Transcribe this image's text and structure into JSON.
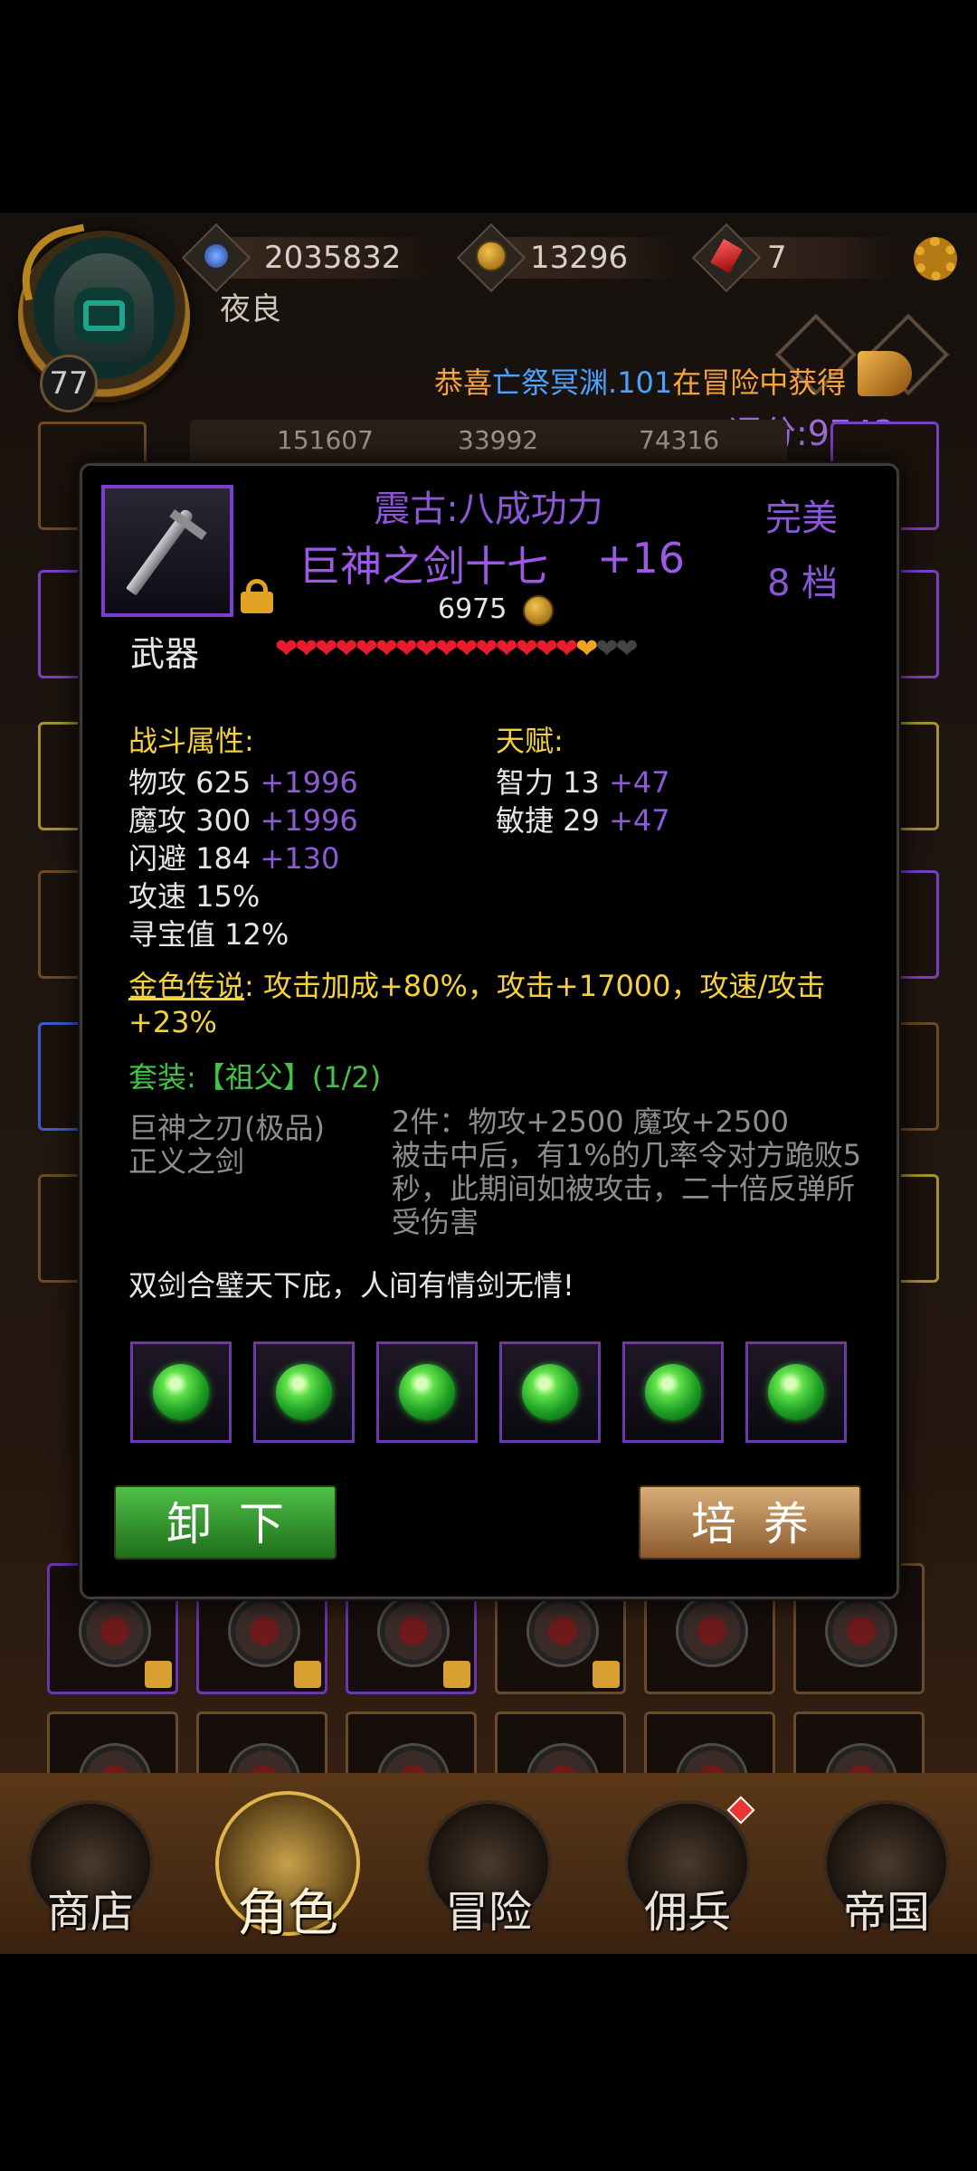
{
  "header": {
    "player_name": "夜良",
    "level": "77",
    "resources": [
      {
        "icon": "blue-gem-icon",
        "value": "2035832"
      },
      {
        "icon": "gold-coin-icon",
        "value": "13296"
      },
      {
        "icon": "ruby-icon",
        "value": "7"
      }
    ],
    "ticker": {
      "prefix": "恭喜",
      "name": "亡祭冥渊.101",
      "suffix": "在冒险中获得"
    },
    "score": "评分:9743"
  },
  "background_stats": [
    "151607",
    "33992",
    "74316"
  ],
  "item": {
    "affix": "震古:八成功力",
    "name": "巨神之剑十七",
    "enhance": "+16",
    "quality": "完美",
    "grade": "8 档",
    "price": "6975",
    "type": "武器",
    "stars_full": 15,
    "stars_half": 1,
    "stars_empty": 2
  },
  "combat": {
    "title": "战斗属性:",
    "stats": [
      {
        "label": "物攻 625",
        "bonus": "+1996"
      },
      {
        "label": "魔攻 300",
        "bonus": "+1996"
      },
      {
        "label": "闪避 184",
        "bonus": "+130"
      },
      {
        "label": "攻速 15%",
        "bonus": ""
      },
      {
        "label": "寻宝值 12%",
        "bonus": ""
      }
    ]
  },
  "talent": {
    "title": "天赋:",
    "stats": [
      {
        "label": "智力 13",
        "bonus": "+47"
      },
      {
        "label": "敏捷 29",
        "bonus": "+47"
      }
    ]
  },
  "legend": {
    "title": "金色传说",
    "text": ": 攻击加成+80%，攻击+17000，攻速/攻击+23%"
  },
  "set": {
    "title": "套装:【祖父】(1/2)",
    "items": [
      "巨神之刃(极品)",
      "正义之剑"
    ],
    "effect_line1": "2件：物攻+2500 魔攻+2500",
    "effect_line2": "被击中后，有1%的几率令对方跪败5秒，此期间如被攻击，二十倍反弹所受伤害"
  },
  "flavor": "双剑合璧天下庇，人间有情剑无情!",
  "sockets": [
    "emerald-icon",
    "emerald-icon",
    "emerald-icon",
    "emerald-icon",
    "emerald-icon",
    "emerald-icon"
  ],
  "buttons": {
    "unequip": "卸下",
    "train": "培养"
  },
  "nav": [
    {
      "label": "商店",
      "icon": "shop-castle-icon"
    },
    {
      "label": "角色",
      "icon": "hooded-character-icon"
    },
    {
      "label": "冒险",
      "icon": "crossed-swords-icon"
    },
    {
      "label": "佣兵",
      "icon": "mercenary-cards-icon"
    },
    {
      "label": "帝国",
      "icon": "crown-icon"
    }
  ],
  "colors": {
    "epic_purple": "#9b59e6",
    "gold_text": "#f5d23a",
    "set_green": "#45c24a",
    "heart_red": "#e81c2c",
    "unequip_green": "#4fbf48",
    "train_tan": "#d9ad78"
  }
}
